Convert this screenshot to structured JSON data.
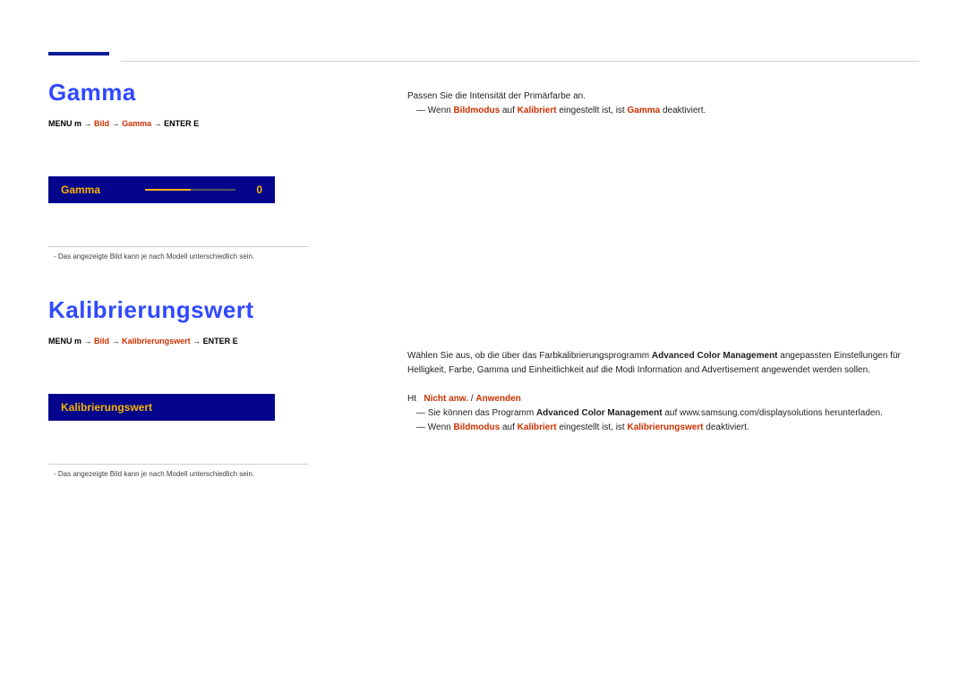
{
  "section1": {
    "title": "Gamma",
    "breadcrumb_part1": "MENU m",
    "breadcrumb_bild": "Bild",
    "breadcrumb_key": "Gamma",
    "breadcrumb_enter": "ENTER E",
    "slider_label": "Gamma",
    "slider_value": "0",
    "footnote": "Das angezeigte Bild kann je nach Modell unterschiedlich sein."
  },
  "section2": {
    "title": "Kalibrierungswert",
    "breadcrumb_part1": "MENU m",
    "breadcrumb_bild": "Bild",
    "breadcrumb_key": "Kalibrierungswert",
    "breadcrumb_enter": "ENTER E",
    "list_label": "Kalibrierungswert",
    "footnote": "Das angezeigte Bild kann je nach Modell unterschiedlich sein."
  },
  "right1": {
    "line1": "Passen Sie die Intensität der Primärfarbe an.",
    "line2_pre": "Wenn ",
    "bildmodus": "Bildmodus",
    "line2_mid": " auf ",
    "kalibriert": "Kalibriert",
    "line2_post": " eingestellt ist, ist ",
    "gamma": "Gamma",
    "line2_end": " deaktiviert."
  },
  "right2": {
    "para1_a": "Wählen Sie aus, ob die über das Farbkalibrierungsprogramm ",
    "acm": "Advanced Color Management",
    "para1_b": " angepassten Einstellungen für Helligkeit, Farbe, Gamma und Einheitlichkeit auf die Modi Information and Advertisement angewendet werden sollen.",
    "option_dot": "Ht",
    "opt_nicht": "Nicht anw.",
    "opt_sep": " / ",
    "opt_anw": "Anwenden",
    "b1_pre": "Sie können das Programm ",
    "b1_acm": "Advanced Color Management",
    "b1_post": " auf www.samsung.com/displaysolutions herunterladen.",
    "b2_pre": "Wenn ",
    "b2_bm": "Bildmodus",
    "b2_mid": " auf ",
    "b2_kal": "Kalibriert",
    "b2_post1": " eingestellt ist, ist ",
    "b2_kw": "Kalibrierungswert",
    "b2_post2": " deaktiviert."
  }
}
